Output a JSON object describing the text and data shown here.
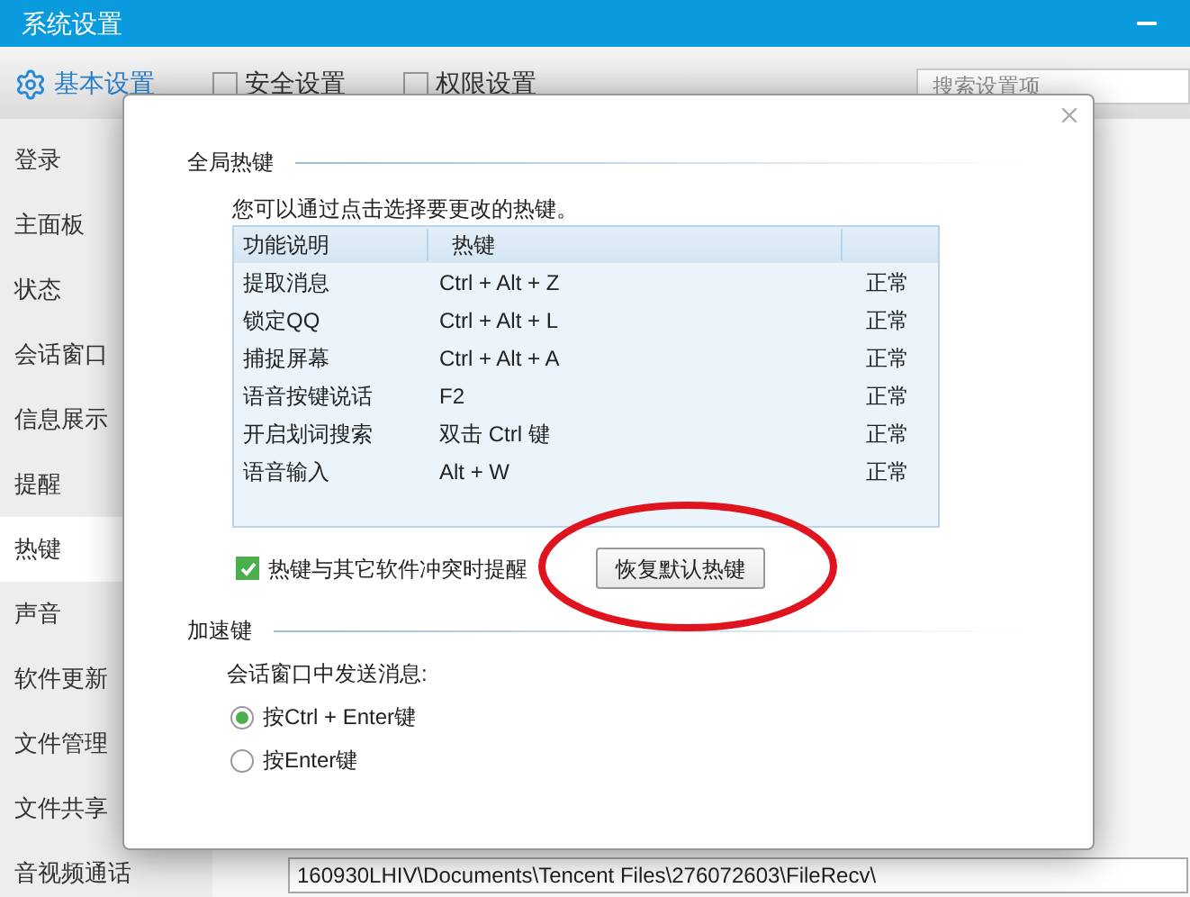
{
  "window": {
    "title": "系统设置"
  },
  "toolbar_tabs": [
    {
      "label": "基本设置",
      "selected": true
    },
    {
      "label": "安全设置",
      "selected": false
    },
    {
      "label": "权限设置",
      "selected": false
    }
  ],
  "search": {
    "placeholder": "搜索设置项"
  },
  "sidebar": {
    "items": [
      {
        "label": "登录",
        "selected": false
      },
      {
        "label": "主面板",
        "selected": false
      },
      {
        "label": "状态",
        "selected": false
      },
      {
        "label": "会话窗口",
        "selected": false
      },
      {
        "label": "信息展示",
        "selected": false
      },
      {
        "label": "提醒",
        "selected": false
      },
      {
        "label": "热键",
        "selected": true
      },
      {
        "label": "声音",
        "selected": false
      },
      {
        "label": "软件更新",
        "selected": false
      },
      {
        "label": "文件管理",
        "selected": false
      },
      {
        "label": "文件共享",
        "selected": false
      },
      {
        "label": "音视频通话",
        "selected": false
      }
    ]
  },
  "path_field": {
    "value": "160930LHIV\\Documents\\Tencent Files\\276072603\\FileRecv\\"
  },
  "dialog": {
    "global_hotkeys": {
      "heading": "全局热键",
      "hint": "您可以通过点击选择要更改的热键。",
      "table": {
        "columns": [
          "功能说明",
          "热键"
        ],
        "rows": [
          {
            "function": "提取消息",
            "hotkey": "Ctrl + Alt + Z",
            "status": "正常"
          },
          {
            "function": "锁定QQ",
            "hotkey": "Ctrl + Alt + L",
            "status": "正常"
          },
          {
            "function": "捕捉屏幕",
            "hotkey": "Ctrl + Alt + A",
            "status": "正常"
          },
          {
            "function": "语音按键说话",
            "hotkey": "F2",
            "status": "正常"
          },
          {
            "function": "开启划词搜索",
            "hotkey": "双击 Ctrl 键",
            "status": "正常"
          },
          {
            "function": "语音输入",
            "hotkey": "Alt + W",
            "status": "正常"
          }
        ]
      },
      "conflict_checkbox": {
        "label": "热键与其它软件冲突时提醒",
        "checked": true
      },
      "restore_button": "恢复默认热键"
    },
    "accelerators": {
      "heading": "加速键",
      "prompt": "会话窗口中发送消息:",
      "options": [
        {
          "label": "按Ctrl + Enter键",
          "selected": true
        },
        {
          "label": "按Enter键",
          "selected": false
        }
      ]
    }
  }
}
